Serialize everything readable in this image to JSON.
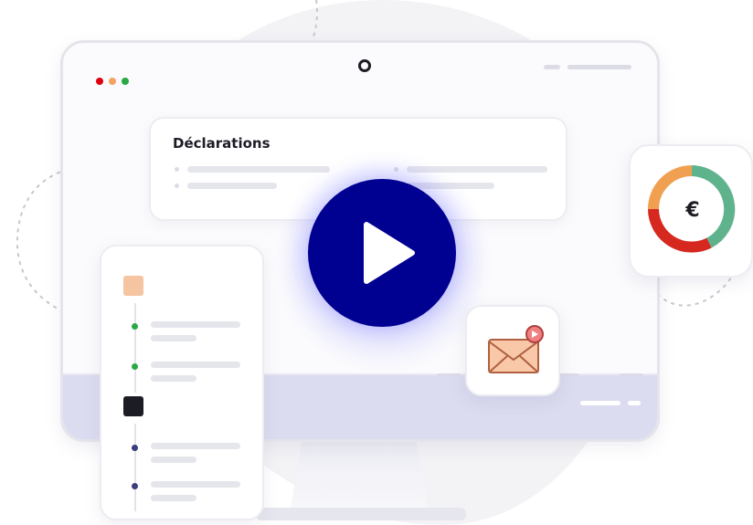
{
  "declarations_card": {
    "title": "Déclarations"
  },
  "euro_card": {
    "symbol": "€"
  },
  "icons": {
    "play": "play-icon",
    "euro": "euro-icon",
    "mail": "mail-icon",
    "camera": "camera-icon"
  },
  "colors": {
    "play_button": "#000091",
    "window_dot_red": "#e1000f",
    "window_dot_orange": "#f4a261",
    "window_dot_green": "#2aa845",
    "ring_green": "#5fb38c",
    "ring_orange": "#f0a050",
    "ring_red": "#d6281e",
    "square_peach": "#f5c4a0",
    "square_black": "#1c1c24",
    "timeline_green": "#2aa845",
    "timeline_navy": "#3c3c80",
    "mail_envelope": "#f8c8a8",
    "mail_badge": "#f08080"
  }
}
